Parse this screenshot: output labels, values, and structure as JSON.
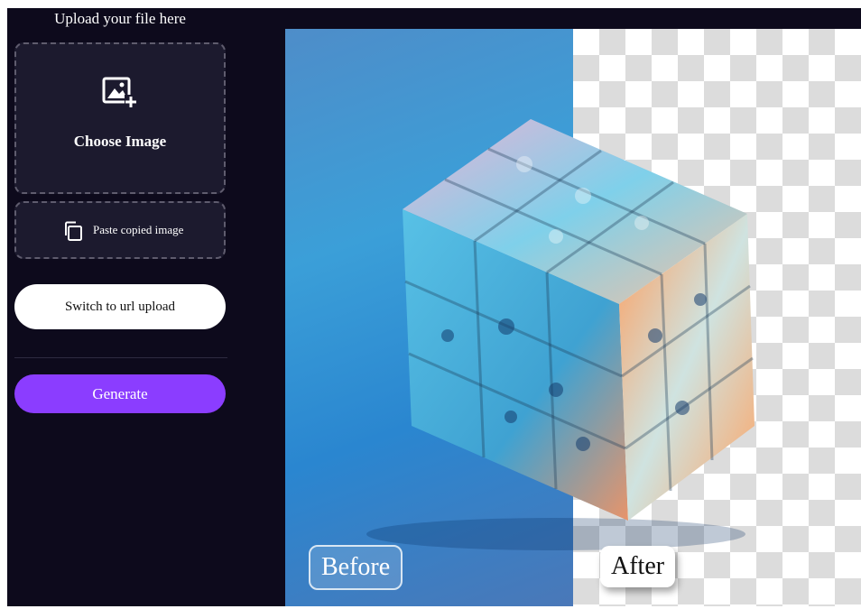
{
  "sidebar": {
    "title": "Upload your file here",
    "choose_image_label": "Choose Image",
    "paste_label": "Paste copied image",
    "switch_label": "Switch to url upload",
    "generate_label": "Generate"
  },
  "preview": {
    "before_label": "Before",
    "after_label": "After"
  },
  "icons": {
    "add_image": "add-image-icon",
    "copy": "copy-icon"
  },
  "colors": {
    "app_background": "#0d0a1c",
    "panel_background": "#1c1a2e",
    "accent": "#8b3dff"
  }
}
